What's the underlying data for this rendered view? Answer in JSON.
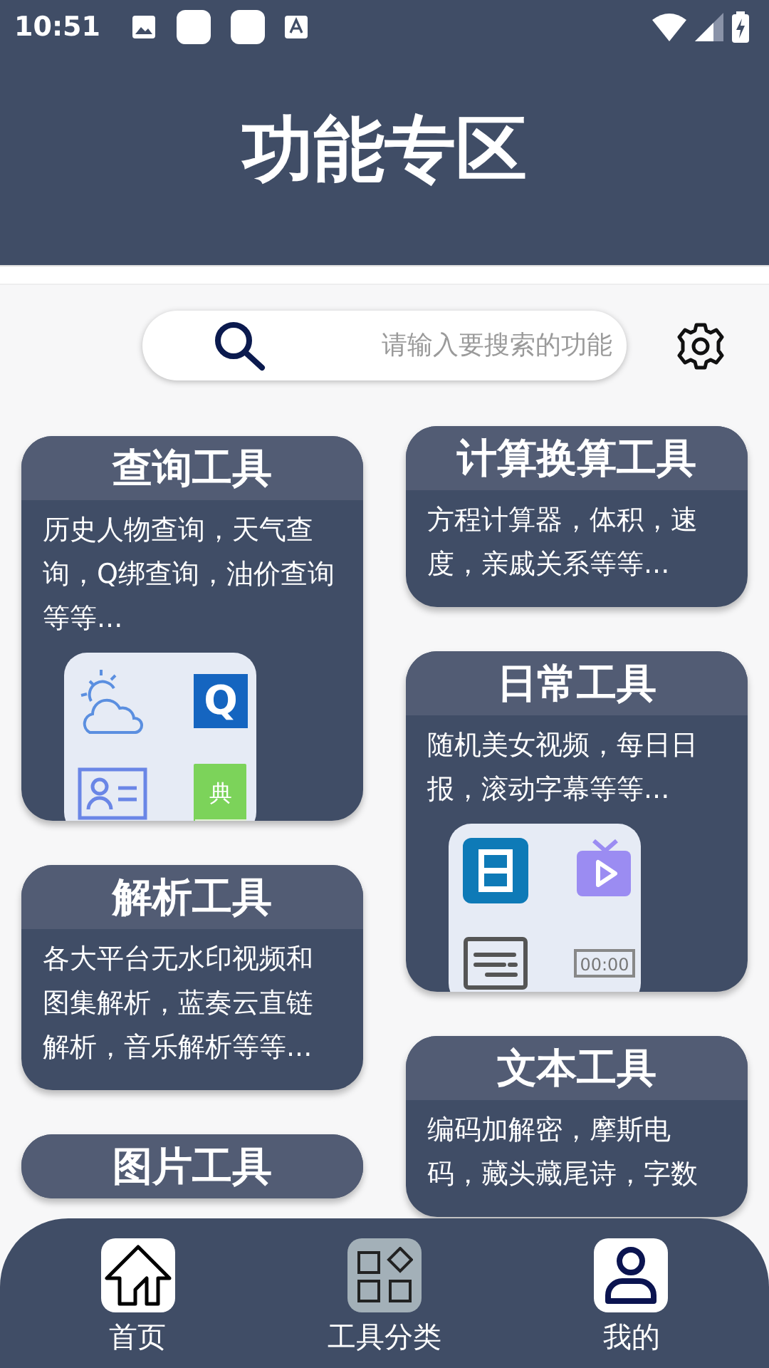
{
  "status_bar": {
    "time": "10:51"
  },
  "header": {
    "title": "功能专区"
  },
  "search": {
    "placeholder": "请输入要搜索的功能"
  },
  "columns": [
    {
      "cards": [
        {
          "title": "查询工具",
          "description": "历史人物查询，天气查询，Q绑查询，油价查询等等...",
          "icons": [
            {
              "kind": "weather"
            },
            {
              "kind": "letter",
              "label": "Q"
            },
            {
              "kind": "id-card"
            },
            {
              "kind": "book",
              "label": "典"
            }
          ]
        },
        {
          "title": "解析工具",
          "description": "各大平台无水印视频和图集解析，蓝奏云直链解析，音乐解析等等..."
        },
        {
          "title": "图片工具"
        }
      ]
    },
    {
      "cards": [
        {
          "title": "计算换算工具",
          "description": "方程计算器，体积，速度，亲戚关系等等..."
        },
        {
          "title": "日常工具",
          "description": "随机美女视频，每日日报，滚动字幕等等...",
          "icons": [
            {
              "kind": "daily"
            },
            {
              "kind": "tv"
            },
            {
              "kind": "subtitle"
            },
            {
              "kind": "timer",
              "label": "00:00"
            }
          ]
        },
        {
          "title": "文本工具",
          "description": "编码加解密，摩斯电码，藏头藏尾诗，字数"
        }
      ]
    }
  ],
  "nav": [
    {
      "label": "首页",
      "kind": "home",
      "selected": false
    },
    {
      "label": "工具分类",
      "kind": "grid",
      "selected": true
    },
    {
      "label": "我的",
      "kind": "user",
      "selected": false
    }
  ]
}
